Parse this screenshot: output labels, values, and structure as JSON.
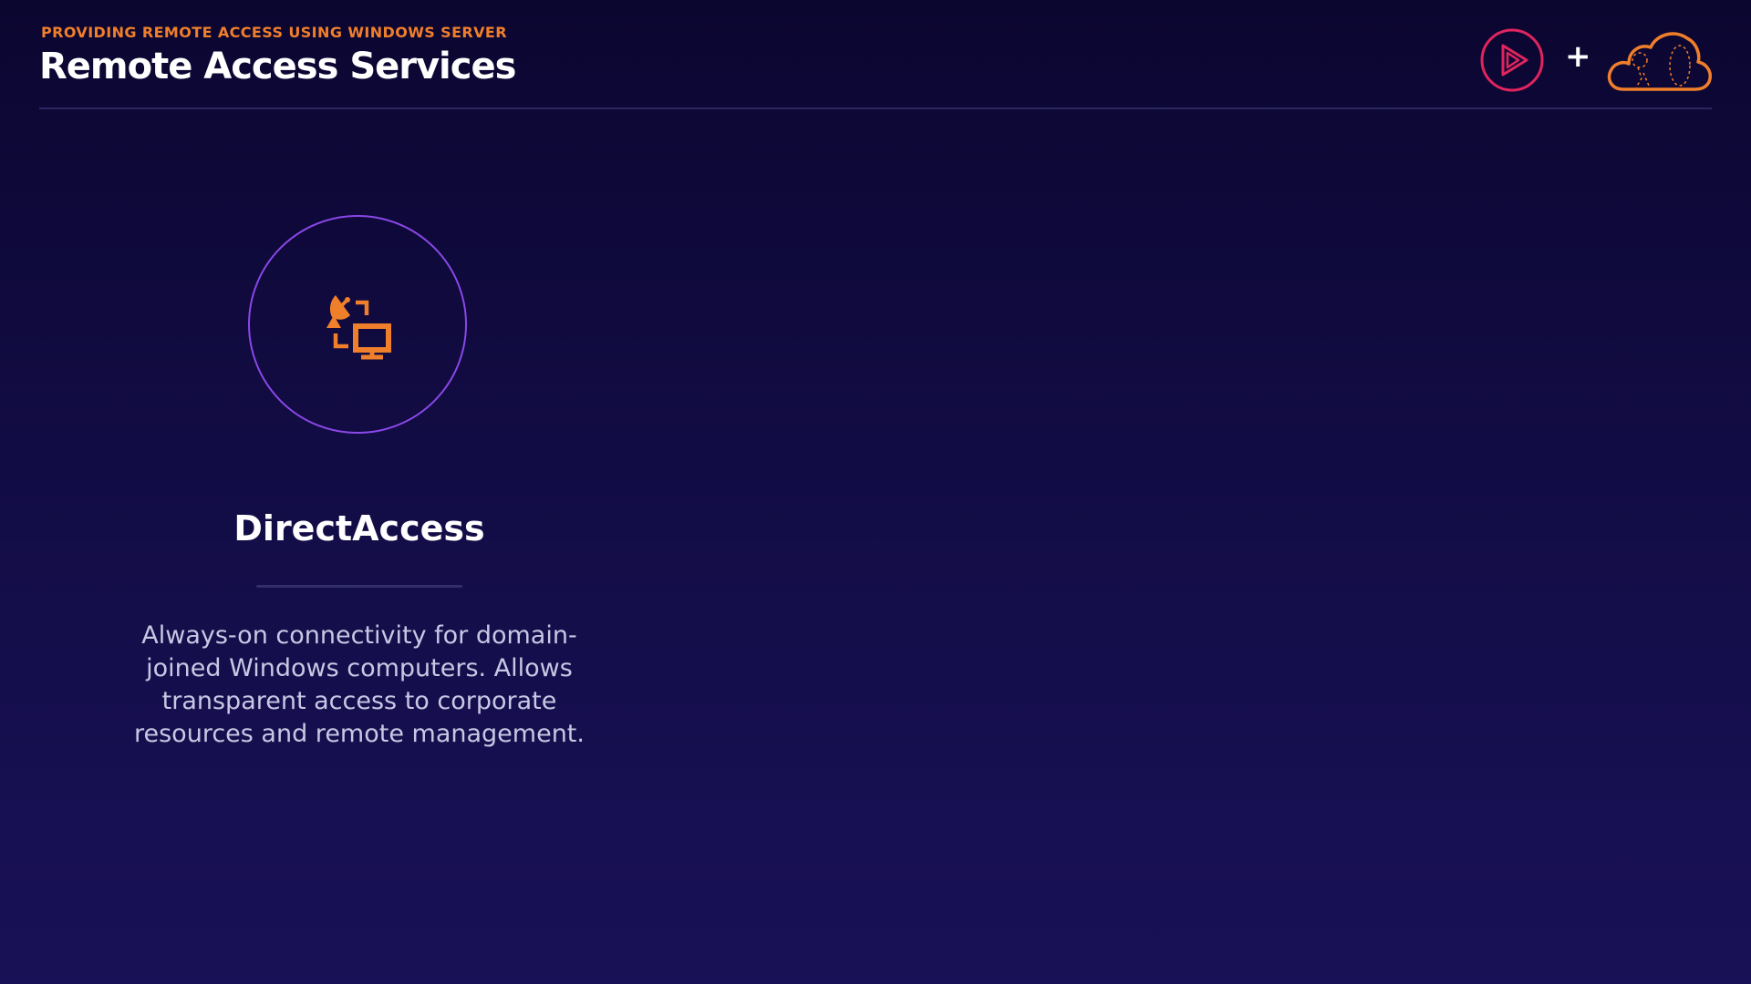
{
  "header": {
    "eyebrow": "PROVIDING REMOTE ACCESS USING WINDOWS SERVER",
    "title": "Remote Access Services",
    "logos": {
      "play_logo_icon": "play-triangle-circle",
      "plus_sign": "+",
      "cloud_logo_icon": "cloud-outline"
    }
  },
  "feature": {
    "icon": "satellite-dish-monitor-transfer-icon",
    "title": "DirectAccess",
    "description": "Always-on connectivity for domain-joined Windows computers. Allows transparent access to corporate resources and remote management."
  },
  "colors": {
    "accent_orange": "#f07f2b",
    "circle_purple": "#8a47e8",
    "play_logo_red": "#e0245e",
    "background_top": "#0b0630",
    "background_bottom": "#191157"
  }
}
